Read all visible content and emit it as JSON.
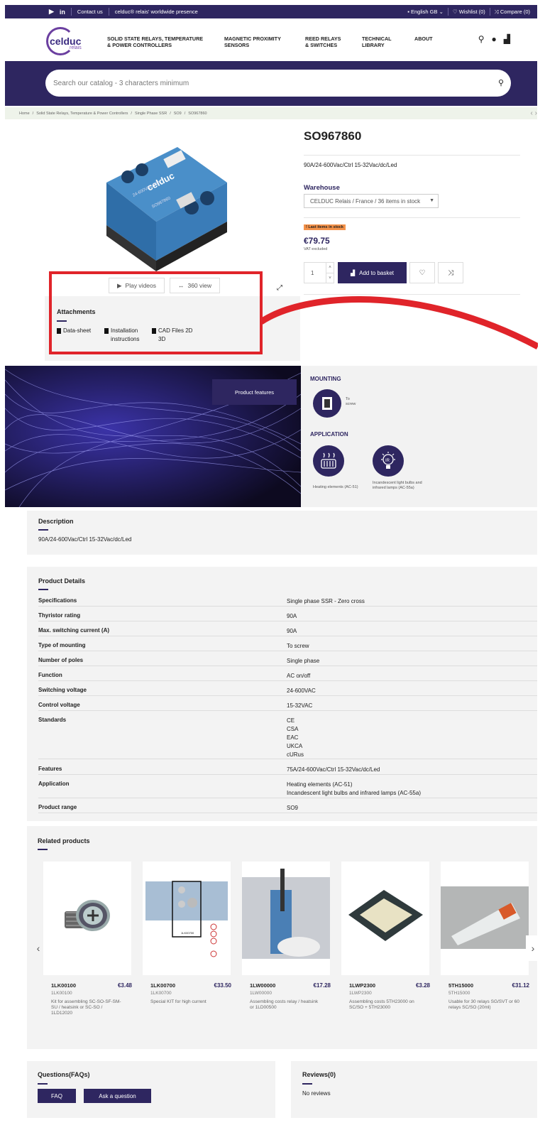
{
  "topbar": {
    "contact": "Contact us",
    "presence": "celduc® relais' worldwide presence",
    "language": "English GB",
    "wishlist": "Wishlist (0)",
    "compare": "Compare (0)"
  },
  "logo": {
    "name": "celduc",
    "sub": "relais"
  },
  "nav": [
    {
      "l1": "SOLID STATE RELAYS, TEMPERATURE",
      "l2": "& POWER CONTROLLERS"
    },
    {
      "l1": "MAGNETIC PROXIMITY",
      "l2": "SENSORS"
    },
    {
      "l1": "REED RELAYS",
      "l2": "& SWITCHES"
    },
    {
      "l1": "TECHNICAL",
      "l2": "LIBRARY"
    },
    {
      "l1": "ABOUT",
      "l2": ""
    }
  ],
  "search": {
    "placeholder": "Search our catalog - 3 characters minimum"
  },
  "breadcrumb": [
    "Home",
    "Solid State Relays, Temperature & Power Controllers",
    "Single Phase SSR",
    "SO9",
    "SO967860"
  ],
  "product": {
    "title": "SO967860",
    "subtitle": "90A/24-600Vac/Ctrl 15-32Vac/dc/Led",
    "warehouse_label": "Warehouse",
    "warehouse_value": "CELDUC Relais / France / 36 items in stock",
    "stock_badge": "! Last items in stock",
    "price": "€79.75",
    "vat": "VAT excluded",
    "qty": "1",
    "add_label": "Add to basket",
    "device_label": "celduc",
    "device_rating": "24-600VAC 90A",
    "device_model": "SO967860"
  },
  "gallery": {
    "play": "Play videos",
    "view360": "360 view",
    "attachments_title": "Attachments",
    "attachments": [
      {
        "l1": "Data-sheet",
        "l2": ""
      },
      {
        "l1": "Installation",
        "l2": "instructions"
      },
      {
        "l1": "CAD Files 2D",
        "l2": "3D"
      }
    ]
  },
  "hero": {
    "button": "Product features"
  },
  "side": {
    "mounting": "MOUNTING",
    "mounting_cap1": "To",
    "mounting_cap2": "screw",
    "application": "APPLICATION",
    "app1": "Heating elements (AC-51)",
    "app2a": "Incandescent light bulbs and",
    "app2b": "infrared lamps (AC-55a)",
    "ir_label": "IR"
  },
  "description": {
    "title": "Description",
    "text": "90A/24-600Vac/Ctrl 15-32Vac/dc/Led"
  },
  "details": {
    "title": "Product Details",
    "rows": [
      {
        "k": "Specifications",
        "v": [
          "Single phase SSR - Zero cross"
        ]
      },
      {
        "k": "Thyristor rating",
        "v": [
          "90A"
        ]
      },
      {
        "k": "Max. switching current (A)",
        "v": [
          "90A"
        ]
      },
      {
        "k": "Type of mounting",
        "v": [
          "To screw"
        ]
      },
      {
        "k": "Number of poles",
        "v": [
          "Single phase"
        ]
      },
      {
        "k": "Function",
        "v": [
          "AC on/off"
        ]
      },
      {
        "k": "Switching voltage",
        "v": [
          "24-600VAC"
        ]
      },
      {
        "k": "Control voltage",
        "v": [
          "15-32VAC"
        ]
      },
      {
        "k": "Standards",
        "v": [
          "CE",
          "CSA",
          "EAC",
          "UKCA",
          "cURus"
        ]
      },
      {
        "k": "Features",
        "v": [
          "75A/24-600Vac/Ctrl 15-32Vac/dc/Led"
        ]
      },
      {
        "k": "Application",
        "v": [
          "Heating elements (AC-51)",
          "Incandescent light bulbs and infrared lamps (AC-55a)"
        ]
      },
      {
        "k": "Product range",
        "v": [
          "SO9"
        ]
      }
    ]
  },
  "related": {
    "title": "Related products",
    "items": [
      {
        "code": "1LK00100",
        "price": "€3.48",
        "sub": "1LK00100",
        "desc": "Kit for assembling SC-SO-SF-SM-SU / heatsink or SC-SO / 1LD12020"
      },
      {
        "code": "1LK00700",
        "price": "€33.50",
        "sub": "1LK00700",
        "desc": "Special KIT for high current",
        "img_label": "1LK00700"
      },
      {
        "code": "1LW00000",
        "price": "€17.28",
        "sub": "1LW00000",
        "desc": "Assembling costs relay / heatsink or 1LD00500"
      },
      {
        "code": "1LWP2300",
        "price": "€3.28",
        "sub": "1LWP2300",
        "desc": "Assembling costs 5TH23000 on SC/SO + 5TH23000"
      },
      {
        "code": "5TH15000",
        "price": "€31.12",
        "sub": "5TH15000",
        "desc": "Usable for 30 relays SG/SVT or 60 relays SC/SO (20ml)"
      }
    ]
  },
  "faq": {
    "title": "Questions(FAQs)",
    "faq_btn": "FAQ",
    "ask_btn": "Ask a question"
  },
  "reviews": {
    "title": "Reviews(0)",
    "none": "No reviews"
  }
}
